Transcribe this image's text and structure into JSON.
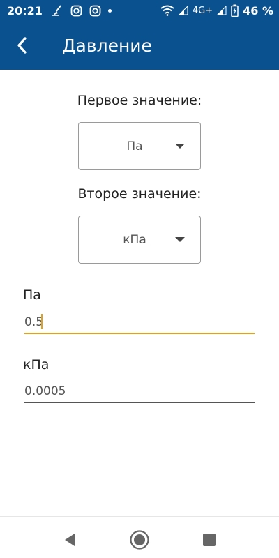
{
  "status_bar": {
    "time": "20:21",
    "network": "4G+",
    "battery": "46 %",
    "icons": [
      "broom-icon",
      "instagram-icon",
      "instagram-icon",
      "notification-dot-icon",
      "wifi-icon",
      "signal-icon",
      "signal-icon",
      "battery-charging-icon"
    ]
  },
  "app_bar": {
    "title": "Давление",
    "back_icon": "back-arrow-icon",
    "background": "#0a5190"
  },
  "first_unit": {
    "label": "Первое значение:",
    "selected": "Па"
  },
  "second_unit": {
    "label": "Второе значение:",
    "selected": "кПа"
  },
  "input_field": {
    "label": "Па",
    "value": "0.5",
    "accent": "#e0a020"
  },
  "output_field": {
    "label": "кПа",
    "value": "0.0005"
  },
  "nav_bar": {
    "icons": [
      "back-triangle-icon",
      "home-circle-icon",
      "recents-square-icon"
    ]
  }
}
